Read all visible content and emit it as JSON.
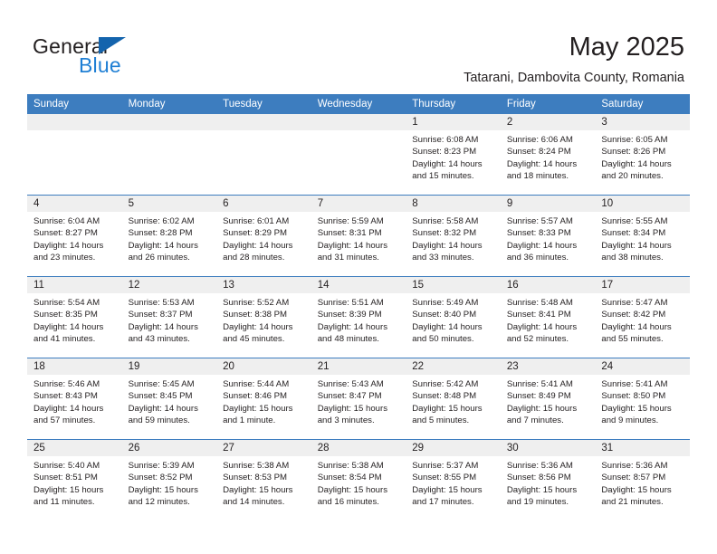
{
  "brand": {
    "word_top": "General",
    "word_bottom": "Blue",
    "triangle_color": "#1464ad",
    "blue_color": "#1f7fd4"
  },
  "header": {
    "title": "May 2025",
    "subtitle": "Tatarani, Dambovita County, Romania"
  },
  "theme": {
    "header_blue": "#3d7dbf",
    "daynum_background": "#efefef",
    "text_color": "#231f20"
  },
  "calendar": {
    "weekday_headers": [
      "Sunday",
      "Monday",
      "Tuesday",
      "Wednesday",
      "Thursday",
      "Friday",
      "Saturday"
    ],
    "weeks": [
      [
        {
          "day": "",
          "empty": true
        },
        {
          "day": "",
          "empty": true
        },
        {
          "day": "",
          "empty": true
        },
        {
          "day": "",
          "empty": true
        },
        {
          "day": "1",
          "sunrise": "Sunrise: 6:08 AM",
          "sunset": "Sunset: 8:23 PM",
          "daylight_line1": "Daylight: 14 hours",
          "daylight_line2": "and 15 minutes."
        },
        {
          "day": "2",
          "sunrise": "Sunrise: 6:06 AM",
          "sunset": "Sunset: 8:24 PM",
          "daylight_line1": "Daylight: 14 hours",
          "daylight_line2": "and 18 minutes."
        },
        {
          "day": "3",
          "sunrise": "Sunrise: 6:05 AM",
          "sunset": "Sunset: 8:26 PM",
          "daylight_line1": "Daylight: 14 hours",
          "daylight_line2": "and 20 minutes."
        }
      ],
      [
        {
          "day": "4",
          "sunrise": "Sunrise: 6:04 AM",
          "sunset": "Sunset: 8:27 PM",
          "daylight_line1": "Daylight: 14 hours",
          "daylight_line2": "and 23 minutes."
        },
        {
          "day": "5",
          "sunrise": "Sunrise: 6:02 AM",
          "sunset": "Sunset: 8:28 PM",
          "daylight_line1": "Daylight: 14 hours",
          "daylight_line2": "and 26 minutes."
        },
        {
          "day": "6",
          "sunrise": "Sunrise: 6:01 AM",
          "sunset": "Sunset: 8:29 PM",
          "daylight_line1": "Daylight: 14 hours",
          "daylight_line2": "and 28 minutes."
        },
        {
          "day": "7",
          "sunrise": "Sunrise: 5:59 AM",
          "sunset": "Sunset: 8:31 PM",
          "daylight_line1": "Daylight: 14 hours",
          "daylight_line2": "and 31 minutes."
        },
        {
          "day": "8",
          "sunrise": "Sunrise: 5:58 AM",
          "sunset": "Sunset: 8:32 PM",
          "daylight_line1": "Daylight: 14 hours",
          "daylight_line2": "and 33 minutes."
        },
        {
          "day": "9",
          "sunrise": "Sunrise: 5:57 AM",
          "sunset": "Sunset: 8:33 PM",
          "daylight_line1": "Daylight: 14 hours",
          "daylight_line2": "and 36 minutes."
        },
        {
          "day": "10",
          "sunrise": "Sunrise: 5:55 AM",
          "sunset": "Sunset: 8:34 PM",
          "daylight_line1": "Daylight: 14 hours",
          "daylight_line2": "and 38 minutes."
        }
      ],
      [
        {
          "day": "11",
          "sunrise": "Sunrise: 5:54 AM",
          "sunset": "Sunset: 8:35 PM",
          "daylight_line1": "Daylight: 14 hours",
          "daylight_line2": "and 41 minutes."
        },
        {
          "day": "12",
          "sunrise": "Sunrise: 5:53 AM",
          "sunset": "Sunset: 8:37 PM",
          "daylight_line1": "Daylight: 14 hours",
          "daylight_line2": "and 43 minutes."
        },
        {
          "day": "13",
          "sunrise": "Sunrise: 5:52 AM",
          "sunset": "Sunset: 8:38 PM",
          "daylight_line1": "Daylight: 14 hours",
          "daylight_line2": "and 45 minutes."
        },
        {
          "day": "14",
          "sunrise": "Sunrise: 5:51 AM",
          "sunset": "Sunset: 8:39 PM",
          "daylight_line1": "Daylight: 14 hours",
          "daylight_line2": "and 48 minutes."
        },
        {
          "day": "15",
          "sunrise": "Sunrise: 5:49 AM",
          "sunset": "Sunset: 8:40 PM",
          "daylight_line1": "Daylight: 14 hours",
          "daylight_line2": "and 50 minutes."
        },
        {
          "day": "16",
          "sunrise": "Sunrise: 5:48 AM",
          "sunset": "Sunset: 8:41 PM",
          "daylight_line1": "Daylight: 14 hours",
          "daylight_line2": "and 52 minutes."
        },
        {
          "day": "17",
          "sunrise": "Sunrise: 5:47 AM",
          "sunset": "Sunset: 8:42 PM",
          "daylight_line1": "Daylight: 14 hours",
          "daylight_line2": "and 55 minutes."
        }
      ],
      [
        {
          "day": "18",
          "sunrise": "Sunrise: 5:46 AM",
          "sunset": "Sunset: 8:43 PM",
          "daylight_line1": "Daylight: 14 hours",
          "daylight_line2": "and 57 minutes."
        },
        {
          "day": "19",
          "sunrise": "Sunrise: 5:45 AM",
          "sunset": "Sunset: 8:45 PM",
          "daylight_line1": "Daylight: 14 hours",
          "daylight_line2": "and 59 minutes."
        },
        {
          "day": "20",
          "sunrise": "Sunrise: 5:44 AM",
          "sunset": "Sunset: 8:46 PM",
          "daylight_line1": "Daylight: 15 hours",
          "daylight_line2": "and 1 minute."
        },
        {
          "day": "21",
          "sunrise": "Sunrise: 5:43 AM",
          "sunset": "Sunset: 8:47 PM",
          "daylight_line1": "Daylight: 15 hours",
          "daylight_line2": "and 3 minutes."
        },
        {
          "day": "22",
          "sunrise": "Sunrise: 5:42 AM",
          "sunset": "Sunset: 8:48 PM",
          "daylight_line1": "Daylight: 15 hours",
          "daylight_line2": "and 5 minutes."
        },
        {
          "day": "23",
          "sunrise": "Sunrise: 5:41 AM",
          "sunset": "Sunset: 8:49 PM",
          "daylight_line1": "Daylight: 15 hours",
          "daylight_line2": "and 7 minutes."
        },
        {
          "day": "24",
          "sunrise": "Sunrise: 5:41 AM",
          "sunset": "Sunset: 8:50 PM",
          "daylight_line1": "Daylight: 15 hours",
          "daylight_line2": "and 9 minutes."
        }
      ],
      [
        {
          "day": "25",
          "sunrise": "Sunrise: 5:40 AM",
          "sunset": "Sunset: 8:51 PM",
          "daylight_line1": "Daylight: 15 hours",
          "daylight_line2": "and 11 minutes."
        },
        {
          "day": "26",
          "sunrise": "Sunrise: 5:39 AM",
          "sunset": "Sunset: 8:52 PM",
          "daylight_line1": "Daylight: 15 hours",
          "daylight_line2": "and 12 minutes."
        },
        {
          "day": "27",
          "sunrise": "Sunrise: 5:38 AM",
          "sunset": "Sunset: 8:53 PM",
          "daylight_line1": "Daylight: 15 hours",
          "daylight_line2": "and 14 minutes."
        },
        {
          "day": "28",
          "sunrise": "Sunrise: 5:38 AM",
          "sunset": "Sunset: 8:54 PM",
          "daylight_line1": "Daylight: 15 hours",
          "daylight_line2": "and 16 minutes."
        },
        {
          "day": "29",
          "sunrise": "Sunrise: 5:37 AM",
          "sunset": "Sunset: 8:55 PM",
          "daylight_line1": "Daylight: 15 hours",
          "daylight_line2": "and 17 minutes."
        },
        {
          "day": "30",
          "sunrise": "Sunrise: 5:36 AM",
          "sunset": "Sunset: 8:56 PM",
          "daylight_line1": "Daylight: 15 hours",
          "daylight_line2": "and 19 minutes."
        },
        {
          "day": "31",
          "sunrise": "Sunrise: 5:36 AM",
          "sunset": "Sunset: 8:57 PM",
          "daylight_line1": "Daylight: 15 hours",
          "daylight_line2": "and 21 minutes."
        }
      ]
    ]
  }
}
